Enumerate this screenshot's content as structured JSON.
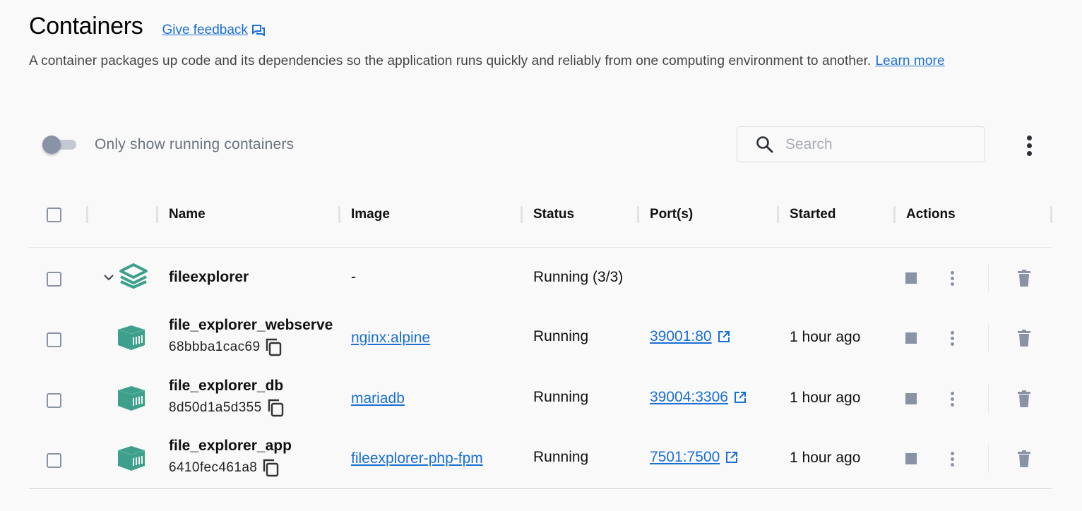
{
  "header": {
    "title": "Containers",
    "feedback_label": "Give feedback",
    "description": "A container packages up code and its dependencies so the application runs quickly and reliably from one computing environment to another.",
    "learn_more_label": "Learn more"
  },
  "filters": {
    "toggle_label": "Only show running containers",
    "toggle_on": false,
    "search_placeholder": "Search",
    "search_value": ""
  },
  "table": {
    "columns": [
      "Name",
      "Image",
      "Status",
      "Port(s)",
      "Started",
      "Actions"
    ],
    "group": {
      "name": "fileexplorer",
      "image": "-",
      "status": "Running (3/3)",
      "expanded": true
    },
    "rows": [
      {
        "name": "file_explorer_webserver",
        "name_visible": "file_explorer_webserve",
        "id": "68bbba1cac69",
        "image": "nginx:alpine",
        "status": "Running",
        "port": "39001:80",
        "started": "1 hour ago"
      },
      {
        "name": "file_explorer_db",
        "name_visible": "file_explorer_db",
        "id": "8d50d1a5d355",
        "image": "mariadb",
        "status": "Running",
        "port": "39004:3306",
        "started": "1 hour ago"
      },
      {
        "name": "file_explorer_app",
        "name_visible": "file_explorer_app",
        "id": "6410fec461a8",
        "image": "fileexplorer-php-fpm",
        "status": "Running",
        "port": "7501:7500",
        "started": "1 hour ago"
      }
    ]
  },
  "colors": {
    "accent_link": "#1a6fd4",
    "container_icon": "#3ea08c",
    "action_icon": "#8a93a5"
  }
}
